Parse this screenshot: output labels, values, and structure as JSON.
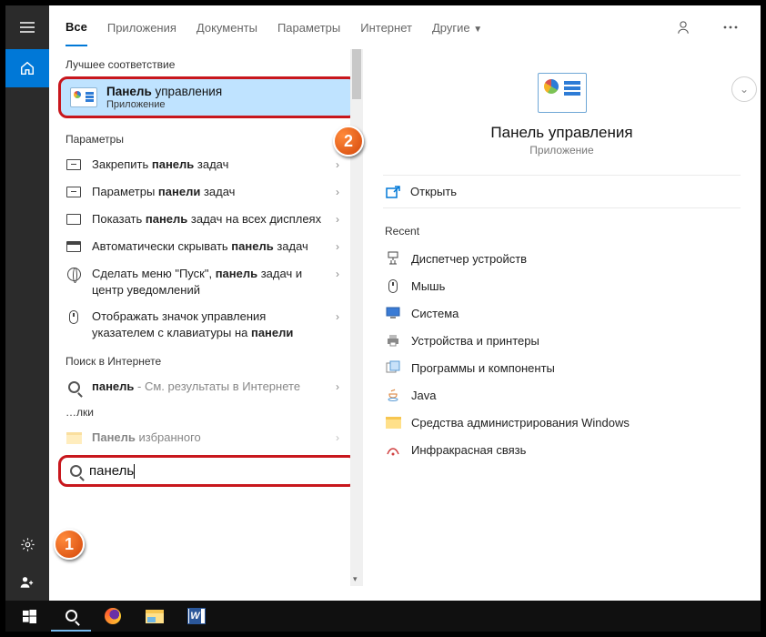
{
  "tabs": {
    "all": "Все",
    "apps": "Приложения",
    "docs": "Документы",
    "settings": "Параметры",
    "internet": "Интернет",
    "more": "Другие"
  },
  "sections": {
    "bestMatch": "Лучшее соответствие",
    "settings": "Параметры",
    "webSearch": "Поиск в Интернете",
    "folders": "…лки"
  },
  "bestMatch": {
    "titleBold": "Панель",
    "titleRest": " управления",
    "subtitle": "Приложение"
  },
  "settingsItems": [
    {
      "pre": "Закрепить ",
      "b": "панель",
      "post": " задач"
    },
    {
      "pre": "Параметры ",
      "b": "панели",
      "post": " задач"
    },
    {
      "pre": "Показать ",
      "b": "панель",
      "post": " задач на всех дисплеях"
    },
    {
      "pre": "Автоматически скрывать ",
      "b": "панель",
      "post": " задач"
    },
    {
      "pre": "Сделать меню \"Пуск\", ",
      "b": "панель",
      "post": " задач и центр уведомлений"
    },
    {
      "pre": "Отображать значок управления указателем с клавиатуры на ",
      "b": "панели",
      "post": ""
    }
  ],
  "webItem": {
    "b": "панель",
    "dim": " - См. результаты в Интернете"
  },
  "folderItem": {
    "b": "Панель",
    "post": " избранного"
  },
  "search": {
    "value": "панель"
  },
  "detail": {
    "title": "Панель управления",
    "subtitle": "Приложение",
    "open": "Открыть",
    "recentTitle": "Recent",
    "recent": [
      "Диспетчер устройств",
      "Мышь",
      "Система",
      "Устройства и принтеры",
      "Программы и компоненты",
      "Java",
      "Средства администрирования Windows",
      "Инфракрасная связь"
    ]
  },
  "callouts": {
    "one": "1",
    "two": "2"
  }
}
